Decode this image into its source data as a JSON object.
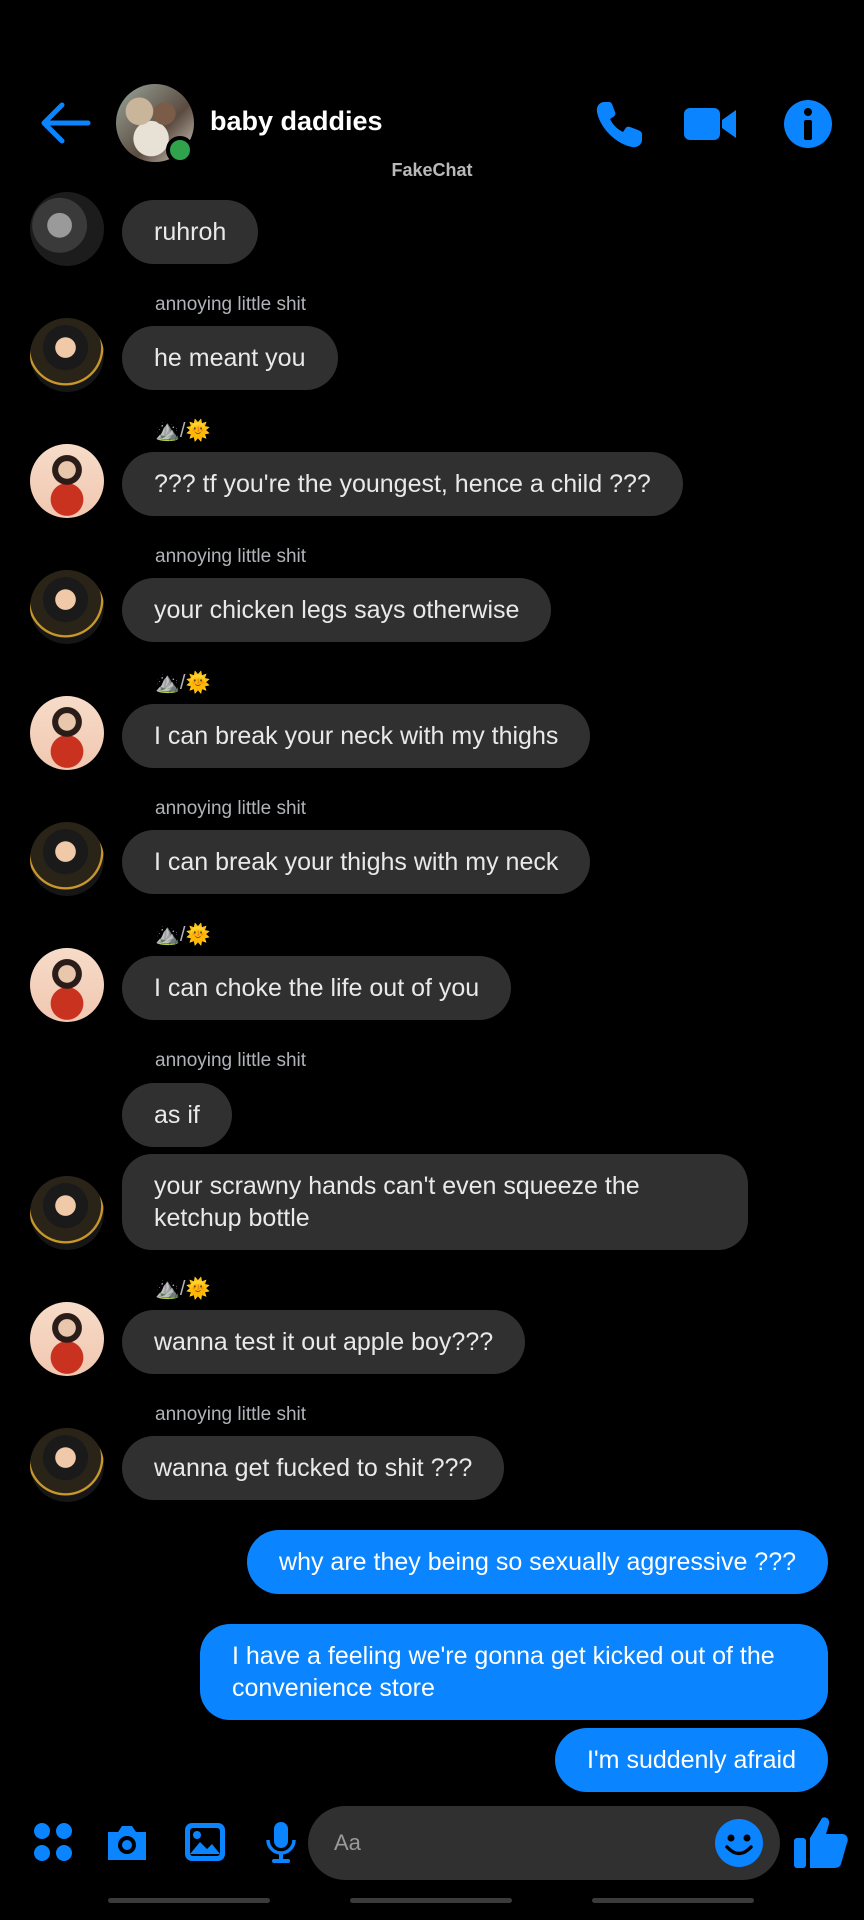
{
  "header": {
    "title": "baby daddies",
    "back_icon": "arrow-left-icon",
    "call_icon": "phone-icon",
    "video_icon": "video-camera-icon",
    "info_icon": "info-icon",
    "accent": "#0a84ff",
    "online": true
  },
  "watermark": "FakeChat",
  "messages": [
    {
      "text": "ruhroh"
    },
    {
      "sender": "annoying little shit",
      "text": "he meant you"
    },
    {
      "sender": "⛰️/🌞",
      "text": "??? tf you're the youngest, hence a child ???"
    },
    {
      "sender": "annoying little shit",
      "text": "your chicken legs says otherwise"
    },
    {
      "sender": "⛰️/🌞",
      "text": "I can break your neck with my thighs"
    },
    {
      "sender": "annoying little shit",
      "text": "I can break your thighs with my neck"
    },
    {
      "sender": "⛰️/🌞",
      "text": "I can choke the life out of you"
    },
    {
      "sender": "annoying little shit",
      "text": "as if"
    },
    {
      "text": "your scrawny hands can't even squeeze the ketchup bottle"
    },
    {
      "sender": "⛰️/🌞",
      "text": "wanna test it out apple boy???"
    },
    {
      "sender": "annoying little shit",
      "text": "wanna get fucked to shit ???"
    },
    {
      "text": "why are they being so sexually aggressive ???",
      "mine": true
    },
    {
      "text": "I have a feeling we're gonna get kicked out of the convenience store",
      "mine": true
    },
    {
      "text": "I'm suddenly afraid",
      "mine": true
    }
  ],
  "composer": {
    "placeholder": "Aa",
    "icons": [
      "apps-icon",
      "camera-icon",
      "gallery-icon",
      "microphone-icon",
      "emoji-icon",
      "thumbs-up-icon"
    ]
  },
  "colors": {
    "bubble_other": "#303030",
    "bubble_mine": "#0a84ff",
    "background": "#000000"
  }
}
